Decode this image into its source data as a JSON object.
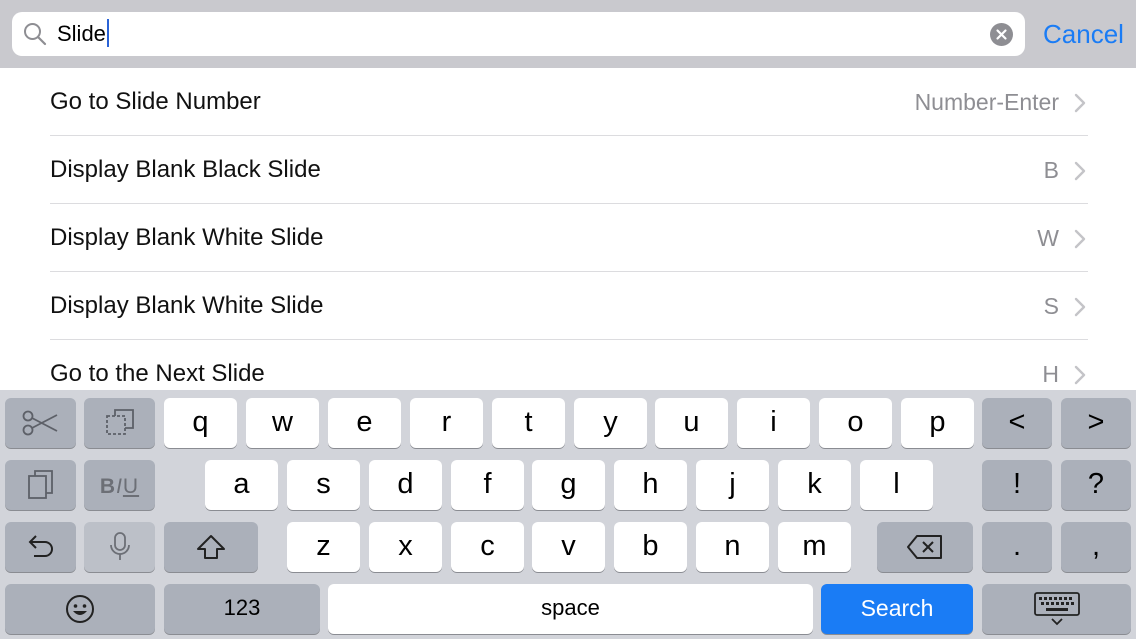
{
  "search": {
    "value": "Slide",
    "cancel_label": "Cancel",
    "icon": "search-icon",
    "clear_icon": "clear-icon"
  },
  "results": [
    {
      "label": "Go to Slide Number",
      "shortcut": "Number-Enter"
    },
    {
      "label": "Display Blank Black Slide",
      "shortcut": "B"
    },
    {
      "label": "Display Blank White Slide",
      "shortcut": "W"
    },
    {
      "label": "Display Blank White Slide",
      "shortcut": "S"
    },
    {
      "label": "Go to the Next Slide",
      "shortcut": "H"
    }
  ],
  "keyboard": {
    "row1": [
      "q",
      "w",
      "e",
      "r",
      "t",
      "y",
      "u",
      "i",
      "o",
      "p"
    ],
    "row2": [
      "a",
      "s",
      "d",
      "f",
      "g",
      "h",
      "j",
      "k",
      "l"
    ],
    "row3": [
      "z",
      "x",
      "c",
      "v",
      "b",
      "n",
      "m"
    ],
    "nav_left": "<",
    "nav_right": ">",
    "exclaim": "!",
    "question": "?",
    "period": ".",
    "comma": ",",
    "numbers_label": "123",
    "space_label": "space",
    "search_label": "Search",
    "format": {
      "bold": "B",
      "italic": "I",
      "underline": "U"
    },
    "icons": [
      "cut-icon",
      "copy-icon",
      "paste-icon",
      "undo-icon",
      "microphone-icon",
      "shift-icon",
      "backspace-icon",
      "emoji-icon",
      "dismiss-keyboard-icon"
    ]
  },
  "colors": {
    "accent": "#1a7cf5",
    "header_bg": "#c9c9ce",
    "keyboard_bg": "#d2d4da",
    "function_key": "#abb0ba",
    "secondary_text": "#8e8e93"
  }
}
